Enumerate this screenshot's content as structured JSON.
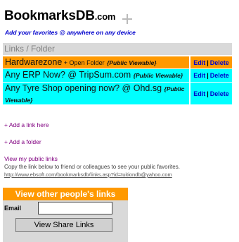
{
  "brand": {
    "name_main": "Bookmarks",
    "name_db": "DB",
    "name_suffix": ".com",
    "tagline": "Add your favorites @ anywhere on any device"
  },
  "folder_header": "Links / Folder",
  "rows": [
    {
      "title": "Hardwarezone",
      "extra": " + Open Folder",
      "viewable": "{Public Viewable}",
      "edit": "Edit",
      "sep": "|",
      "delete": "Delete"
    },
    {
      "title": "Any ERP Now? @ TripSum.com",
      "viewable": "{Public Viewable}",
      "edit": "Edit",
      "sep": "|",
      "delete": "Delete"
    },
    {
      "title": "Any Tyre Shop opening now? @ Ohd.sg",
      "viewable": "{Public Viewable}",
      "edit": "Edit",
      "sep": "|",
      "delete": "Delete"
    }
  ],
  "actions": {
    "add_link": "+ Add a link here",
    "add_folder": "+ Add a folder",
    "view_public": "View my public links",
    "copy_note": "Copy the link below to friend or colleagues to see your public favorites.",
    "public_url": "http://www.ebsoft.com/bookmarksdb/links.asp?id=tuitiondb@yahoo.com"
  },
  "others": {
    "title": "View other people's links",
    "email_label": "Email",
    "email_value": "",
    "button_label": "View Share Links"
  },
  "colors": {
    "orange": "#ff9900",
    "cyan": "#00ffff",
    "link_blue": "#0000cc",
    "visited_purple": "#800080"
  }
}
